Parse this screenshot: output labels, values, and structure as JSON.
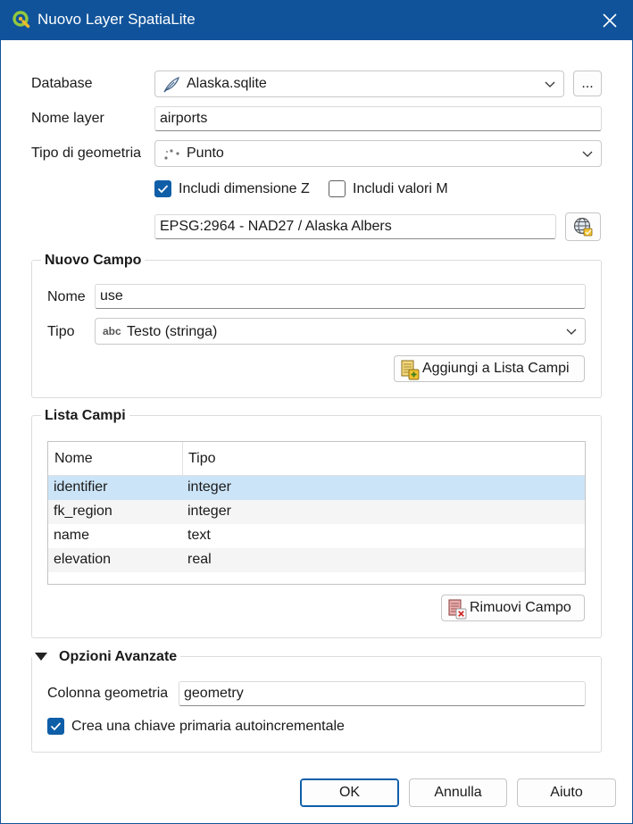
{
  "window": {
    "title": "Nuovo Layer SpatiaLite",
    "app_icon": "qgis-logo-icon",
    "close_icon": "close-icon"
  },
  "form": {
    "database_label": "Database",
    "database_value": "Alaska.sqlite",
    "database_icon": "feather-icon",
    "browse_label": "...",
    "layer_name_label": "Nome layer",
    "layer_name_value": "airports",
    "geometry_type_label": "Tipo di geometria",
    "geometry_type_value": "Punto",
    "geometry_type_icon": "point-icon",
    "include_z_label": "Includi dimensione Z",
    "include_z_checked": true,
    "include_m_label": "Includi valori M",
    "include_m_checked": false,
    "crs_value": "EPSG:2964 - NAD27 / Alaska Albers",
    "crs_icon": "globe-crs-icon"
  },
  "new_field": {
    "title": "Nuovo Campo",
    "name_label": "Nome",
    "name_value": "use",
    "type_label": "Tipo",
    "type_badge": "abc",
    "type_value": "Testo (stringa)",
    "add_button_label": "Aggiungi a Lista Campi",
    "add_button_icon": "add-field-icon"
  },
  "field_list": {
    "title": "Lista Campi",
    "columns": [
      "Nome",
      "Tipo"
    ],
    "rows": [
      {
        "name": "identifier",
        "type": "integer"
      },
      {
        "name": "fk_region",
        "type": "integer"
      },
      {
        "name": "name",
        "type": "text"
      },
      {
        "name": "elevation",
        "type": "real"
      }
    ],
    "selected_row": 0,
    "remove_button_label": "Rimuovi Campo",
    "remove_button_icon": "remove-field-icon"
  },
  "advanced": {
    "title": "Opzioni Avanzate",
    "expanded": true,
    "geometry_column_label": "Colonna geometria",
    "geometry_column_value": "geometry",
    "autoincrement_label": "Crea una chiave primaria autoincrementale",
    "autoincrement_checked": true
  },
  "buttons": {
    "ok": "OK",
    "cancel": "Annulla",
    "help": "Aiuto"
  },
  "colors": {
    "titlebar": "#10539a",
    "accent": "#0f5ea8",
    "selection": "#cce4f7"
  }
}
